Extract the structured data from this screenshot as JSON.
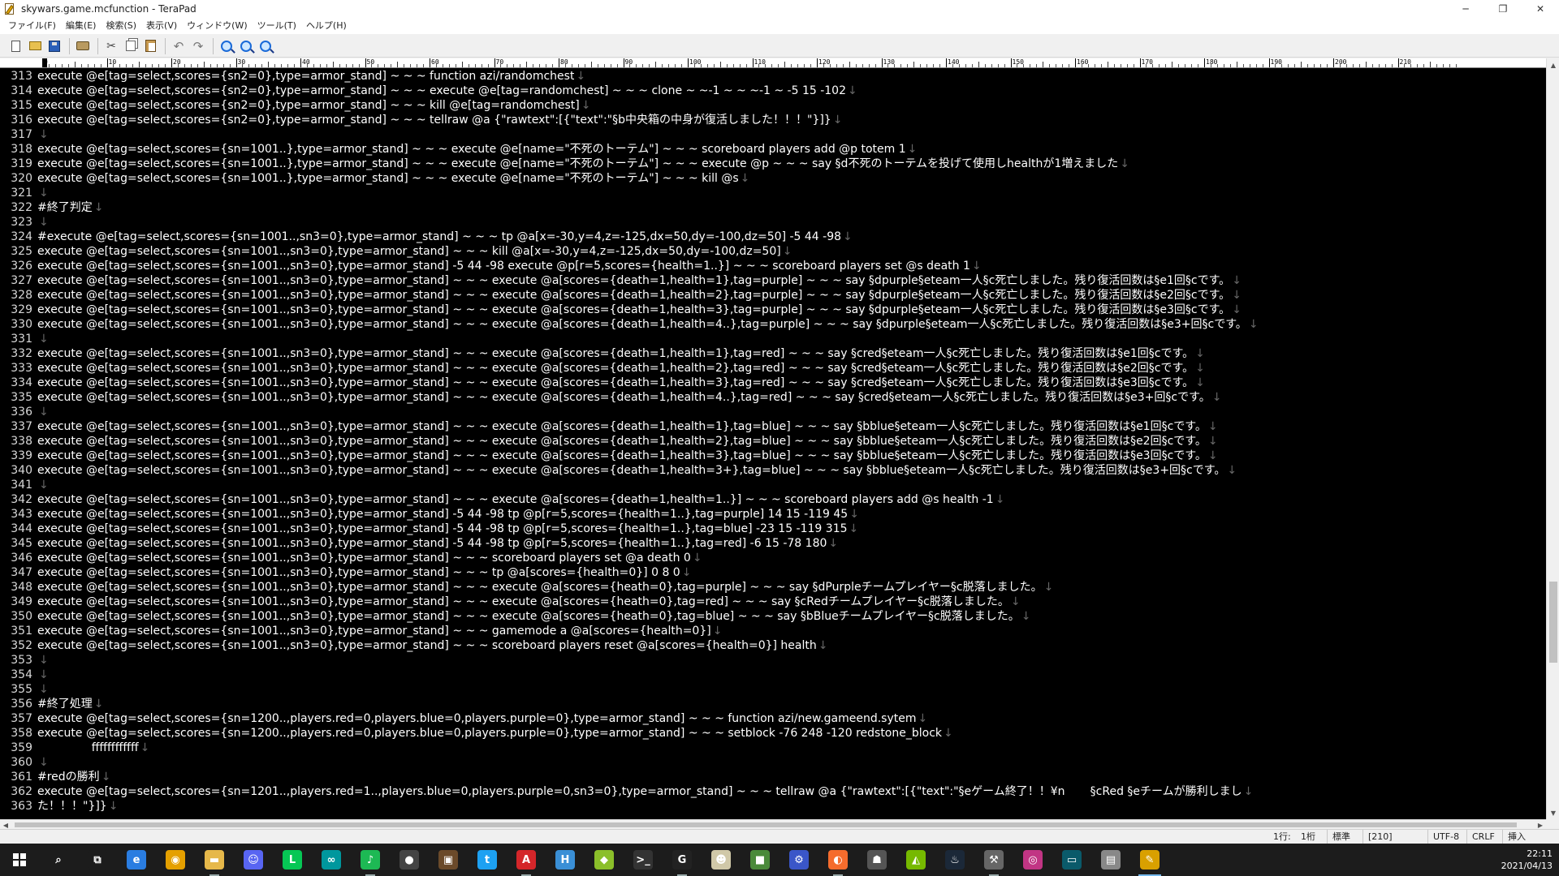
{
  "window": {
    "title": "skywars.game.mcfunction - TeraPad",
    "minimize": "─",
    "restore": "❐",
    "close": "✕"
  },
  "menu": [
    "ファイル(F)",
    "編集(E)",
    "検索(S)",
    "表示(V)",
    "ウィンドウ(W)",
    "ツール(T)",
    "ヘルプ(H)"
  ],
  "toolbar_icons": [
    "new-file-icon",
    "open-folder-icon",
    "save-icon",
    "print-icon",
    "cut-icon",
    "copy-icon",
    "paste-icon",
    "undo-icon",
    "redo-icon",
    "find-icon",
    "find-next-icon",
    "find-prev-icon"
  ],
  "ruler": [
    "0",
    "10",
    "20",
    "30",
    "40",
    "50",
    "60",
    "70",
    "80",
    "90",
    "100",
    "110",
    "120",
    "130",
    "140",
    "150",
    "160",
    "170",
    "180",
    "190",
    "200",
    "210"
  ],
  "lines": [
    {
      "n": "313",
      "t": "execute @e[tag=select,scores={sn2=0},type=armor_stand] ~ ~ ~ function azi/randomchest"
    },
    {
      "n": "314",
      "t": "execute @e[tag=select,scores={sn2=0},type=armor_stand] ~ ~ ~ execute @e[tag=randomchest] ~ ~ ~ clone ~ ~-1 ~ ~ ~-1 ~ -5 15 -102"
    },
    {
      "n": "315",
      "t": "execute @e[tag=select,scores={sn2=0},type=armor_stand] ~ ~ ~ kill @e[tag=randomchest]"
    },
    {
      "n": "316",
      "t": "execute @e[tag=select,scores={sn2=0},type=armor_stand] ~ ~ ~ tellraw @a {\"rawtext\":[{\"text\":\"§b中央箱の中身が復活しました！！！\"}]}"
    },
    {
      "n": "317",
      "t": ""
    },
    {
      "n": "318",
      "t": "execute @e[tag=select,scores={sn=1001..},type=armor_stand] ~ ~ ~ execute @e[name=\"不死のトーテム\"] ~ ~ ~ scoreboard players add @p totem 1"
    },
    {
      "n": "319",
      "t": "execute @e[tag=select,scores={sn=1001..},type=armor_stand] ~ ~ ~ execute @e[name=\"不死のトーテム\"] ~ ~ ~ execute @p ~ ~ ~ say §d不死のトーテムを投げて使用しhealthが1増えました"
    },
    {
      "n": "320",
      "t": "execute @e[tag=select,scores={sn=1001..},type=armor_stand] ~ ~ ~ execute @e[name=\"不死のトーテム\"] ~ ~ ~ kill @s"
    },
    {
      "n": "321",
      "t": ""
    },
    {
      "n": "322",
      "t": "#終了判定"
    },
    {
      "n": "323",
      "t": ""
    },
    {
      "n": "324",
      "t": "#execute @e[tag=select,scores={sn=1001..,sn3=0},type=armor_stand] ~ ~ ~ tp @a[x=-30,y=4,z=-125,dx=50,dy=-100,dz=50] -5 44 -98"
    },
    {
      "n": "325",
      "t": "execute @e[tag=select,scores={sn=1001..,sn3=0},type=armor_stand] ~ ~ ~ kill @a[x=-30,y=4,z=-125,dx=50,dy=-100,dz=50]"
    },
    {
      "n": "326",
      "t": "execute @e[tag=select,scores={sn=1001..,sn3=0},type=armor_stand] -5 44 -98 execute @p[r=5,scores={health=1..}] ~ ~ ~ scoreboard players set @s death 1"
    },
    {
      "n": "327",
      "t": "execute @e[tag=select,scores={sn=1001..,sn3=0},type=armor_stand] ~ ~ ~ execute @a[scores={death=1,health=1},tag=purple] ~ ~ ~ say §dpurple§eteam一人§c死亡しました。残り復活回数は§e1回§cです。"
    },
    {
      "n": "328",
      "t": "execute @e[tag=select,scores={sn=1001..,sn3=0},type=armor_stand] ~ ~ ~ execute @a[scores={death=1,health=2},tag=purple] ~ ~ ~ say §dpurple§eteam一人§c死亡しました。残り復活回数は§e2回§cです。"
    },
    {
      "n": "329",
      "t": "execute @e[tag=select,scores={sn=1001..,sn3=0},type=armor_stand] ~ ~ ~ execute @a[scores={death=1,health=3},tag=purple] ~ ~ ~ say §dpurple§eteam一人§c死亡しました。残り復活回数は§e3回§cです。"
    },
    {
      "n": "330",
      "t": "execute @e[tag=select,scores={sn=1001..,sn3=0},type=armor_stand] ~ ~ ~ execute @a[scores={death=1,health=4..},tag=purple] ~ ~ ~ say §dpurple§eteam一人§c死亡しました。残り復活回数は§e3+回§cです。"
    },
    {
      "n": "331",
      "t": ""
    },
    {
      "n": "332",
      "t": "execute @e[tag=select,scores={sn=1001..,sn3=0},type=armor_stand] ~ ~ ~ execute @a[scores={death=1,health=1},tag=red] ~ ~ ~ say §cred§eteam一人§c死亡しました。残り復活回数は§e1回§cです。"
    },
    {
      "n": "333",
      "t": "execute @e[tag=select,scores={sn=1001..,sn3=0},type=armor_stand] ~ ~ ~ execute @a[scores={death=1,health=2},tag=red] ~ ~ ~ say §cred§eteam一人§c死亡しました。残り復活回数は§e2回§cです。"
    },
    {
      "n": "334",
      "t": "execute @e[tag=select,scores={sn=1001..,sn3=0},type=armor_stand] ~ ~ ~ execute @a[scores={death=1,health=3},tag=red] ~ ~ ~ say §cred§eteam一人§c死亡しました。残り復活回数は§e3回§cです。"
    },
    {
      "n": "335",
      "t": "execute @e[tag=select,scores={sn=1001..,sn3=0},type=armor_stand] ~ ~ ~ execute @a[scores={death=1,health=4..},tag=red] ~ ~ ~ say §cred§eteam一人§c死亡しました。残り復活回数は§e3+回§cです。"
    },
    {
      "n": "336",
      "t": ""
    },
    {
      "n": "337",
      "t": "execute @e[tag=select,scores={sn=1001..,sn3=0},type=armor_stand] ~ ~ ~ execute @a[scores={death=1,health=1},tag=blue] ~ ~ ~ say §bblue§eteam一人§c死亡しました。残り復活回数は§e1回§cです。"
    },
    {
      "n": "338",
      "t": "execute @e[tag=select,scores={sn=1001..,sn3=0},type=armor_stand] ~ ~ ~ execute @a[scores={death=1,health=2},tag=blue] ~ ~ ~ say §bblue§eteam一人§c死亡しました。残り復活回数は§e2回§cです。"
    },
    {
      "n": "339",
      "t": "execute @e[tag=select,scores={sn=1001..,sn3=0},type=armor_stand] ~ ~ ~ execute @a[scores={death=1,health=3},tag=blue] ~ ~ ~ say §bblue§eteam一人§c死亡しました。残り復活回数は§e3回§cです。"
    },
    {
      "n": "340",
      "t": "execute @e[tag=select,scores={sn=1001..,sn3=0},type=armor_stand] ~ ~ ~ execute @a[scores={death=1,health=3+},tag=blue] ~ ~ ~ say §bblue§eteam一人§c死亡しました。残り復活回数は§e3+回§cです。"
    },
    {
      "n": "341",
      "t": ""
    },
    {
      "n": "342",
      "t": "execute @e[tag=select,scores={sn=1001..,sn3=0},type=armor_stand] ~ ~ ~ execute @a[scores={death=1,health=1..}] ~ ~ ~ scoreboard players add @s health -1"
    },
    {
      "n": "343",
      "t": "execute @e[tag=select,scores={sn=1001..,sn3=0},type=armor_stand] -5 44 -98 tp @p[r=5,scores={health=1..},tag=purple] 14 15 -119 45"
    },
    {
      "n": "344",
      "t": "execute @e[tag=select,scores={sn=1001..,sn3=0},type=armor_stand] -5 44 -98 tp @p[r=5,scores={health=1..},tag=blue] -23 15 -119 315"
    },
    {
      "n": "345",
      "t": "execute @e[tag=select,scores={sn=1001..,sn3=0},type=armor_stand] -5 44 -98 tp @p[r=5,scores={health=1..},tag=red] -6 15 -78 180"
    },
    {
      "n": "346",
      "t": "execute @e[tag=select,scores={sn=1001..,sn3=0},type=armor_stand] ~ ~ ~ scoreboard players set @a death 0"
    },
    {
      "n": "347",
      "t": "execute @e[tag=select,scores={sn=1001..,sn3=0},type=armor_stand] ~ ~ ~ tp @a[scores={health=0}] 0 8 0"
    },
    {
      "n": "348",
      "t": "execute @e[tag=select,scores={sn=1001..,sn3=0},type=armor_stand] ~ ~ ~ execute @a[scores={heath=0},tag=purple] ~ ~ ~ say §dPurpleチームプレイヤー§c脱落しました。"
    },
    {
      "n": "349",
      "t": "execute @e[tag=select,scores={sn=1001..,sn3=0},type=armor_stand] ~ ~ ~ execute @a[scores={heath=0},tag=red] ~ ~ ~ say §cRedチームプレイヤー§c脱落しました。"
    },
    {
      "n": "350",
      "t": "execute @e[tag=select,scores={sn=1001..,sn3=0},type=armor_stand] ~ ~ ~ execute @a[scores={heath=0},tag=blue] ~ ~ ~ say §bBlueチームプレイヤー§c脱落しました。"
    },
    {
      "n": "351",
      "t": "execute @e[tag=select,scores={sn=1001..,sn3=0},type=armor_stand] ~ ~ ~ gamemode a @a[scores={health=0}]"
    },
    {
      "n": "352",
      "t": "execute @e[tag=select,scores={sn=1001..,sn3=0},type=armor_stand] ~ ~ ~ scoreboard players reset @a[scores={health=0}] health"
    },
    {
      "n": "353",
      "t": ""
    },
    {
      "n": "354",
      "t": ""
    },
    {
      "n": "355",
      "t": ""
    },
    {
      "n": "356",
      "t": "#終了処理"
    },
    {
      "n": "357",
      "t": "execute @e[tag=select,scores={sn=1200..,players.red=0,players.blue=0,players.purple=0},type=armor_stand] ~ ~ ~ function azi/new.gameend.sytem"
    },
    {
      "n": "358",
      "t": "execute @e[tag=select,scores={sn=1200..,players.red=0,players.blue=0,players.purple=0},type=armor_stand] ~ ~ ~ setblock -76 248 -120 redstone_block"
    },
    {
      "n": "359",
      "t": "               ffffffffffff"
    },
    {
      "n": "360",
      "t": ""
    },
    {
      "n": "361",
      "t": "#redの勝利"
    },
    {
      "n": "362",
      "t": "execute @e[tag=select,scores={sn=1201..,players.red=1..,players.blue=0,players.purple=0,sn3=0},type=armor_stand] ~ ~ ~ tellraw @a {\"rawtext\":[{\"text\":\"§eゲーム終了！！¥n       §cRed §eチームが勝利しまし"
    },
    {
      "n": "363",
      "t": "た！！！\"}]}"
    }
  ],
  "eol_mark": "↓",
  "status": {
    "line": "1行:",
    "col": "1桁",
    "mode": "標準",
    "width": "[210]",
    "encoding": "UTF-8",
    "newline": "CRLF",
    "insert": "挿入"
  },
  "taskbar": {
    "apps": [
      {
        "name": "search-taskbar-icon",
        "glyph": "⌕",
        "color": "#1c1c1c"
      },
      {
        "name": "task-view-icon",
        "glyph": "⧉",
        "color": "#1c1c1c"
      },
      {
        "name": "edge-icon",
        "glyph": "e",
        "color": "#2a7de1"
      },
      {
        "name": "chrome-icon",
        "glyph": "◉",
        "color": "#e5a000"
      },
      {
        "name": "explorer-icon",
        "glyph": "▬",
        "color": "#e6b84a"
      },
      {
        "name": "discord-icon",
        "glyph": "☺",
        "color": "#5865f2"
      },
      {
        "name": "line-icon",
        "glyph": "L",
        "color": "#06c755"
      },
      {
        "name": "arduino-icon",
        "glyph": "∞",
        "color": "#00979d"
      },
      {
        "name": "spotify-icon",
        "glyph": "♪",
        "color": "#1db954"
      },
      {
        "name": "steam-alt-icon",
        "glyph": "●",
        "color": "#444"
      },
      {
        "name": "minecraft-icon",
        "glyph": "▣",
        "color": "#6b4a2a"
      },
      {
        "name": "twitter-icon",
        "glyph": "t",
        "color": "#1da1f2"
      },
      {
        "name": "acrobat-icon",
        "glyph": "A",
        "color": "#d4262a"
      },
      {
        "name": "h-app-icon",
        "glyph": "H",
        "color": "#3a8fd6"
      },
      {
        "name": "cube-icon",
        "glyph": "◆",
        "color": "#8bbf2a"
      },
      {
        "name": "terminal-icon",
        "glyph": ">_",
        "color": "#333"
      },
      {
        "name": "g-app-icon",
        "glyph": "G",
        "color": "#222"
      },
      {
        "name": "character-icon",
        "glyph": "☻",
        "color": "#d0c8a8"
      },
      {
        "name": "block-icon",
        "glyph": "■",
        "color": "#4a8a3a"
      },
      {
        "name": "mixer-icon",
        "glyph": "⚙",
        "color": "#3a56c8"
      },
      {
        "name": "origin-icon",
        "glyph": "◐",
        "color": "#f56c2d"
      },
      {
        "name": "cheat-icon",
        "glyph": "☗",
        "color": "#555"
      },
      {
        "name": "nvidia-icon",
        "glyph": "◭",
        "color": "#76b900"
      },
      {
        "name": "steam-icon",
        "glyph": "♨",
        "color": "#1b2838"
      },
      {
        "name": "tool-icon",
        "glyph": "⚒",
        "color": "#666"
      },
      {
        "name": "instagram-icon",
        "glyph": "◎",
        "color": "#c13584"
      },
      {
        "name": "terminal2-icon",
        "glyph": "▭",
        "color": "#0a5a6a"
      },
      {
        "name": "folder-icon",
        "glyph": "▤",
        "color": "#888"
      },
      {
        "name": "terapad-icon",
        "glyph": "✎",
        "color": "#d9a000"
      }
    ],
    "time": "22:11",
    "date": "2021/04/13"
  }
}
